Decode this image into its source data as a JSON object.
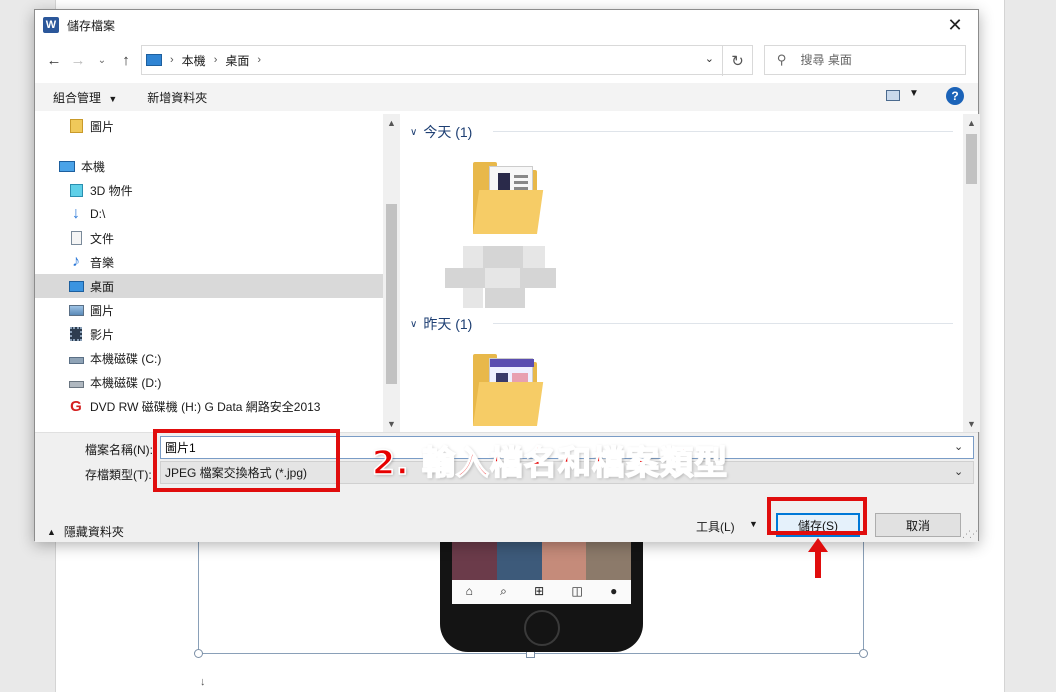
{
  "dialog": {
    "title": "儲存檔案",
    "app_icon_letter": "W",
    "close_glyph": "✕"
  },
  "address": {
    "crumbs": [
      "本機",
      "桌面"
    ],
    "separator": "›",
    "search_placeholder": "搜尋 桌面"
  },
  "toolbar": {
    "organize_label": "組合管理",
    "new_folder_label": "新增資料夾",
    "help_label": "?"
  },
  "nav_pane": {
    "items": [
      {
        "label": "圖片",
        "icon": "folder-icon"
      },
      {
        "label": "本機",
        "icon": "pc-icon"
      },
      {
        "label": "3D 物件",
        "icon": "3d-objects-icon"
      },
      {
        "label": "D:\\",
        "icon": "download-icon"
      },
      {
        "label": "文件",
        "icon": "documents-icon"
      },
      {
        "label": "音樂",
        "icon": "music-icon"
      },
      {
        "label": "桌面",
        "icon": "desktop-icon",
        "selected": true
      },
      {
        "label": "圖片",
        "icon": "pictures-icon"
      },
      {
        "label": "影片",
        "icon": "videos-icon"
      },
      {
        "label": "本機磁碟 (C:)",
        "icon": "drive-icon"
      },
      {
        "label": "本機磁碟 (D:)",
        "icon": "drive-icon"
      },
      {
        "label": "DVD RW 磁碟機 (H:) G Data 網路安全2013",
        "icon": "gdata-shield-icon"
      }
    ]
  },
  "file_pane": {
    "groups": [
      {
        "label": "今天 (1)"
      },
      {
        "label": "昨天 (1)"
      }
    ]
  },
  "save_form": {
    "filename_label": "檔案名稱(N):",
    "filename_value": "圖片1",
    "filetype_label": "存檔類型(T):",
    "filetype_value": "JPEG 檔案交換格式 (*.jpg)",
    "hide_folders_label": "隱藏資料夾",
    "tools_label": "工具(L)",
    "save_label": "儲存(S)",
    "cancel_label": "取消"
  },
  "annotation": {
    "text": "2. 輸入檔名和檔案類型",
    "color": "#e60000"
  },
  "colors": {
    "accent": "#0078d7",
    "annotation_red": "#e00d0d",
    "word_blue": "#2b579a"
  }
}
